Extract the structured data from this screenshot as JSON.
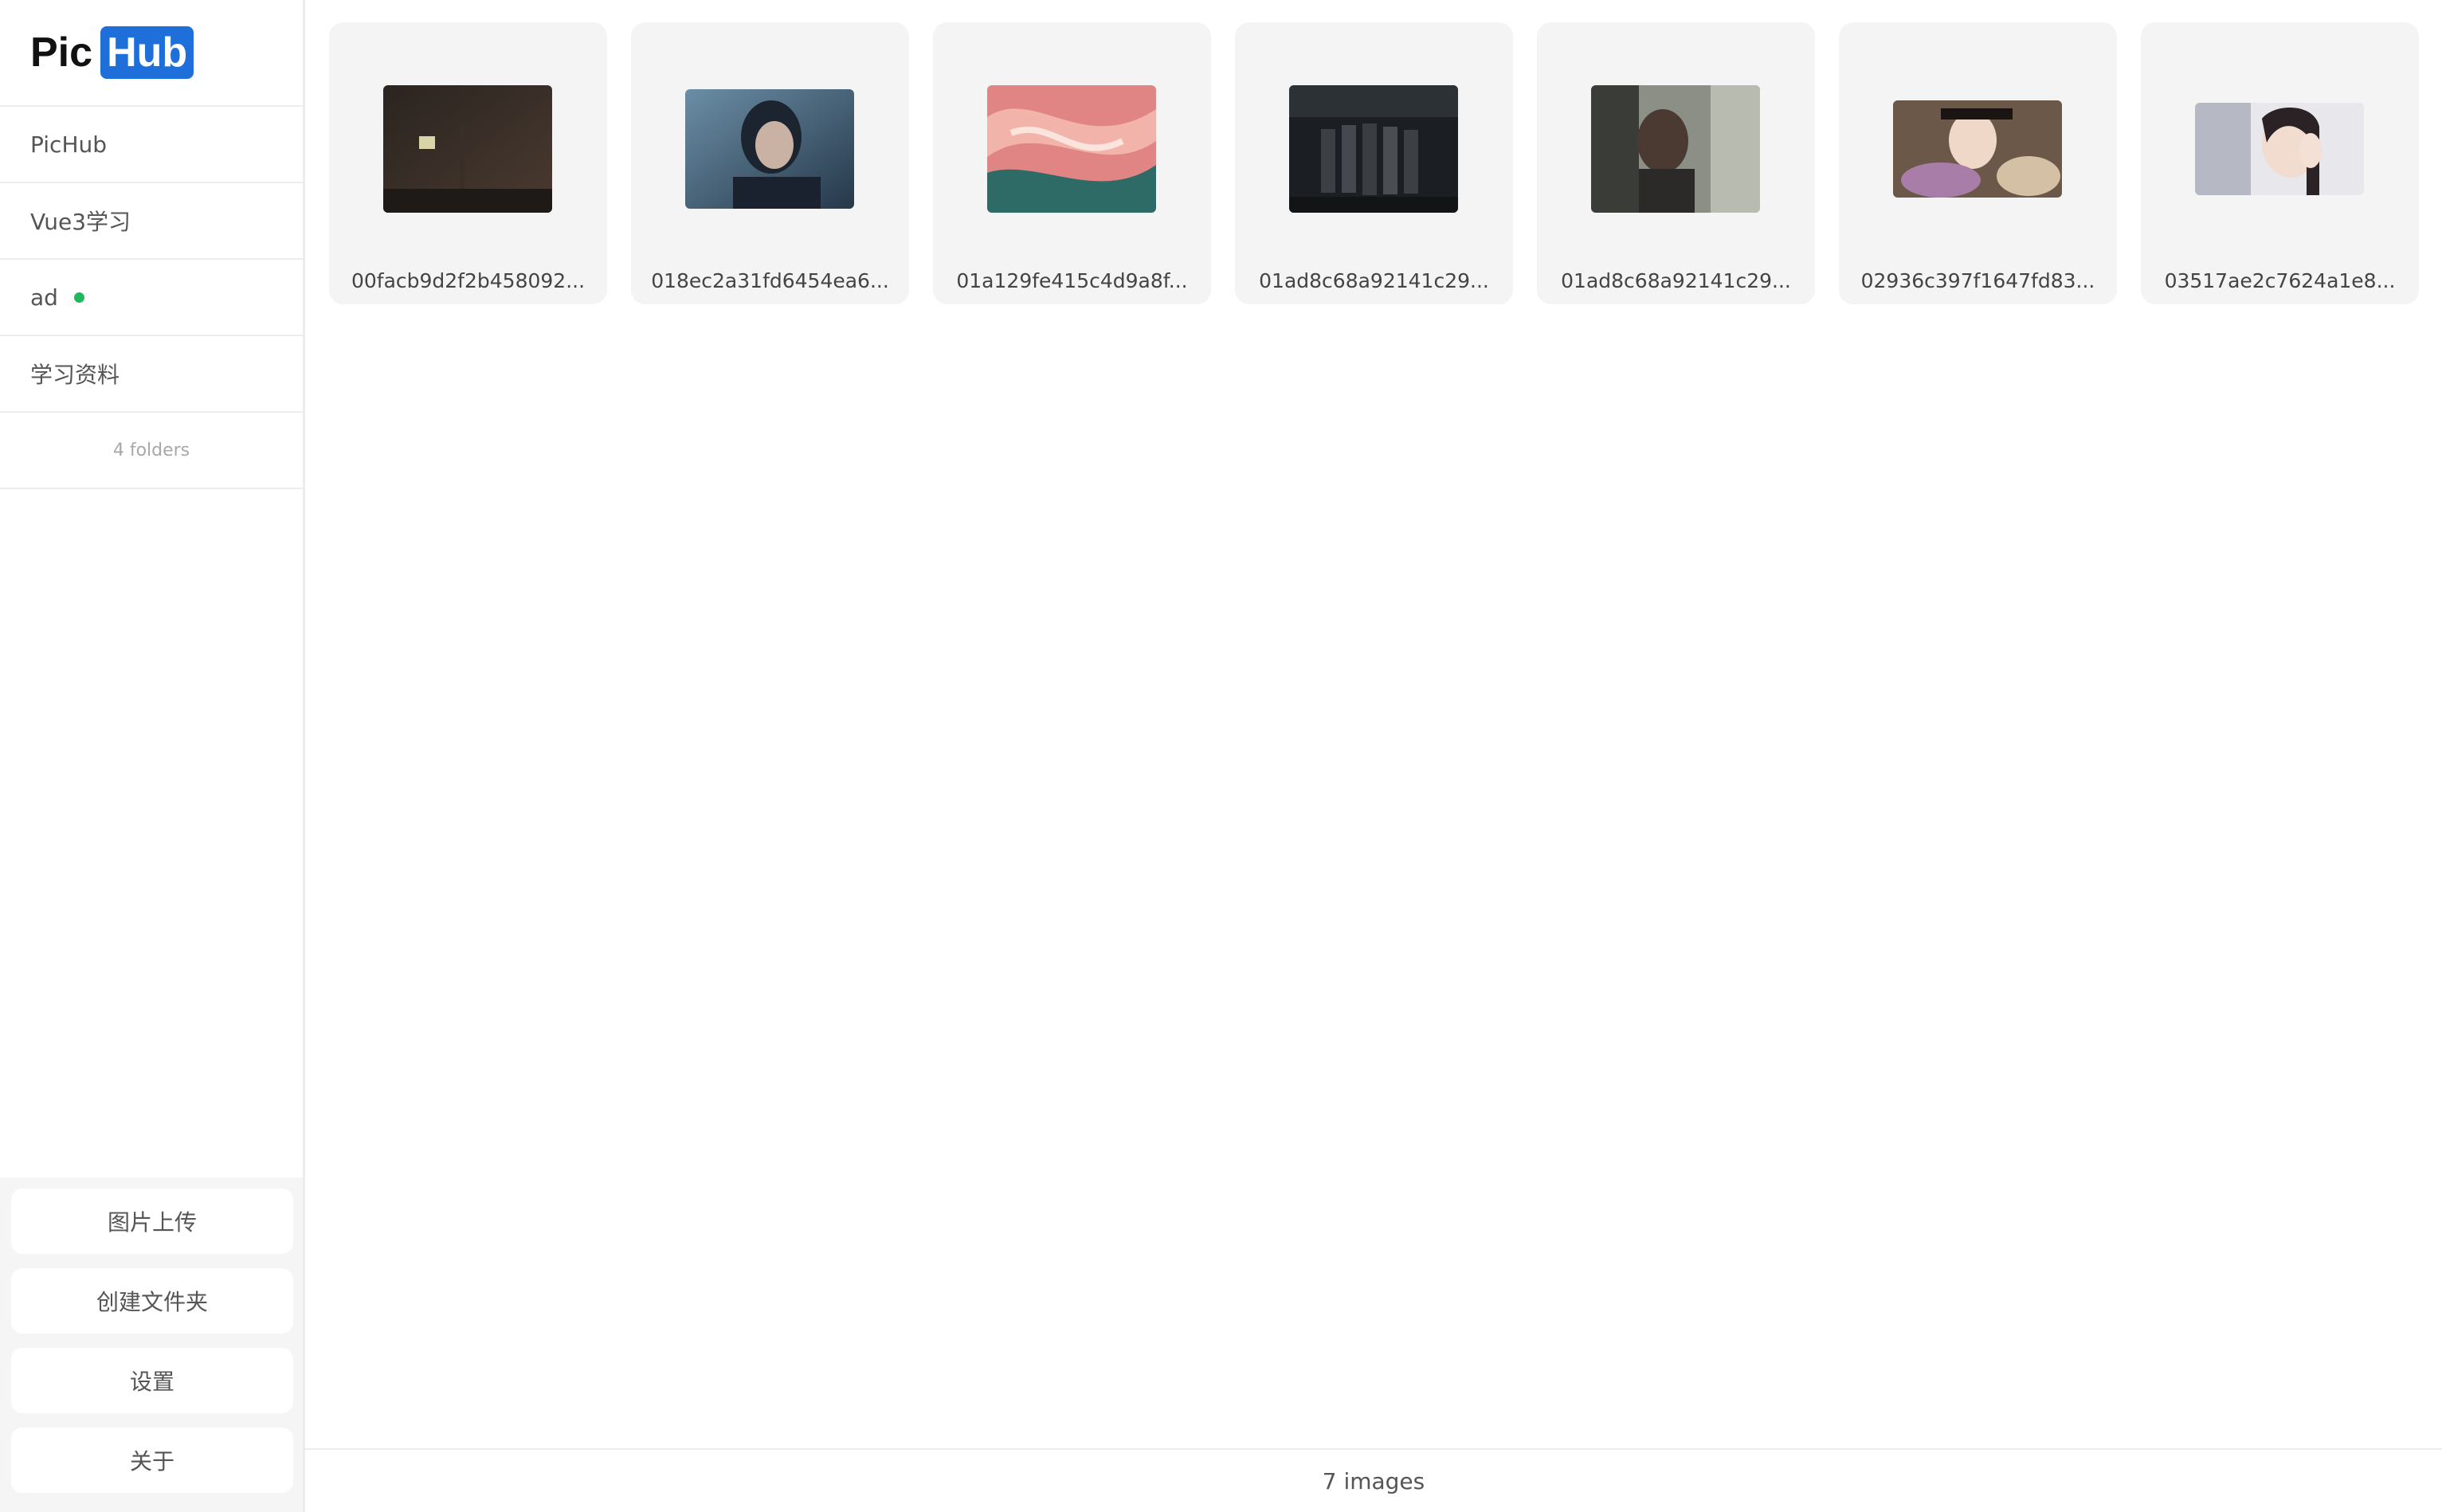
{
  "brand": {
    "part1": "Pic",
    "part2": "Hub",
    "accent": "#1e6fd9"
  },
  "sidebar": {
    "folders": [
      {
        "label": "PicHub"
      },
      {
        "label": "Vue3学习"
      },
      {
        "label": "ad",
        "status": "active",
        "status_color": "#1fb85c"
      },
      {
        "label": "学习资料"
      }
    ],
    "folder_count": "4 folders",
    "actions": [
      {
        "label": "图片上传"
      },
      {
        "label": "创建文件夹"
      },
      {
        "label": "设置"
      },
      {
        "label": "关于"
      }
    ]
  },
  "gallery": {
    "images": [
      {
        "name": "00facb9d2f2b458092...",
        "thumb_style": "dark-room"
      },
      {
        "name": "018ec2a31fd6454ea6...",
        "thumb_style": "blue-portrait"
      },
      {
        "name": "01a129fe415c4d9a8f...",
        "thumb_style": "pink-marble"
      },
      {
        "name": "01ad8c68a92141c29...",
        "thumb_style": "group-dark"
      },
      {
        "name": "01ad8c68a92141c29...",
        "thumb_style": "window-portrait"
      },
      {
        "name": "02936c397f1647fd83...",
        "thumb_style": "flowers-portrait"
      },
      {
        "name": "03517ae2c7624a1e8...",
        "thumb_style": "soft-portrait"
      }
    ]
  },
  "footer": {
    "count_text": "7 images"
  }
}
